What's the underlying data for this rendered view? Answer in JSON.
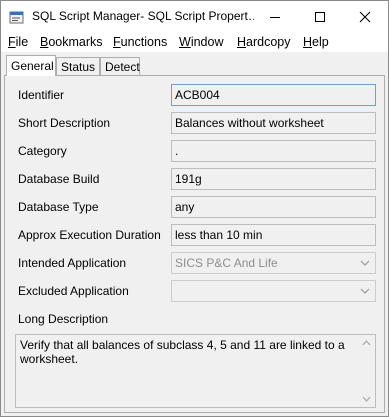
{
  "window": {
    "title": "SQL Script Manager- SQL Script Propert…"
  },
  "menubar": {
    "items": [
      {
        "first": "F",
        "rest": "ile"
      },
      {
        "first": "B",
        "rest": "ookmarks"
      },
      {
        "first": "F",
        "rest": "unctions"
      },
      {
        "first": "W",
        "rest": "indow"
      },
      {
        "first": "H",
        "rest": "ardcopy"
      },
      {
        "first": "H",
        "rest": "elp"
      }
    ]
  },
  "tabs": [
    "General",
    "Status",
    "Detect"
  ],
  "active_tab": "General",
  "form": {
    "identifier": {
      "label": "Identifier",
      "value": "ACB004"
    },
    "short_description": {
      "label": "Short Description",
      "value": "Balances without worksheet"
    },
    "category": {
      "label": "Category",
      "value": "."
    },
    "database_build": {
      "label": "Database Build",
      "value": "191g"
    },
    "database_type": {
      "label": "Database Type",
      "value": "any"
    },
    "approx_execution_duration": {
      "label": "Approx Execution Duration",
      "value": "less than 10 min"
    },
    "intended_application": {
      "label": "Intended Application",
      "value": "SICS P&C And Life"
    },
    "excluded_application": {
      "label": "Excluded Application",
      "value": ""
    },
    "long_description": {
      "label": "Long Description",
      "value": "Verify that all balances of subclass 4, 5 and 11 are linked to a worksheet."
    }
  },
  "colors": {
    "window_bg": "#f0f0f0",
    "titlebar_bg": "#ffffff",
    "focus_border": "#7a9cc6",
    "disabled_text": "#8d8d8d"
  },
  "icons": {
    "app": "sql-script-manager-icon",
    "minimize": "minimize-icon",
    "maximize": "maximize-icon",
    "close": "close-icon",
    "dropdown": "chevron-down-icon"
  }
}
